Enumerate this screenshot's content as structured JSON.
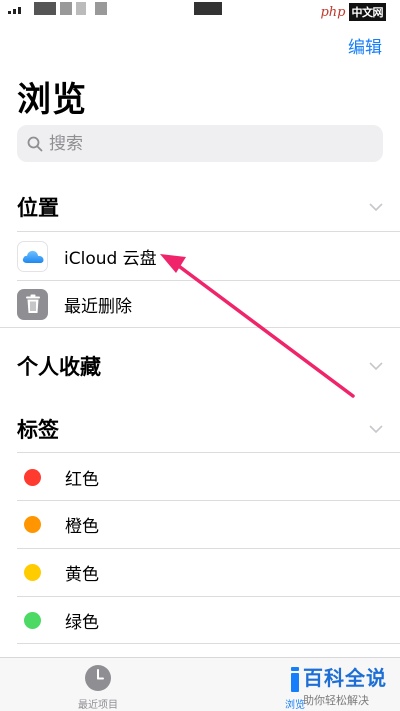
{
  "header": {
    "edit_label": "编辑",
    "title": "浏览"
  },
  "search": {
    "placeholder": "搜索"
  },
  "sections": {
    "locations": {
      "title": "位置",
      "items": [
        {
          "label": "iCloud 云盘",
          "icon": "icloud-icon"
        },
        {
          "label": "最近删除",
          "icon": "trash-icon"
        }
      ]
    },
    "favorites": {
      "title": "个人收藏"
    },
    "tags": {
      "title": "标签",
      "items": [
        {
          "label": "红色",
          "color": "#ff3b30"
        },
        {
          "label": "橙色",
          "color": "#ff9500"
        },
        {
          "label": "黄色",
          "color": "#ffcc00"
        },
        {
          "label": "绿色",
          "color": "#4cd964"
        }
      ]
    }
  },
  "tab_bar": {
    "tabs": [
      {
        "label": "最近项目",
        "icon": "clock-icon",
        "active": false
      },
      {
        "label": "浏览",
        "icon": "folder-icon",
        "active": true
      }
    ]
  },
  "watermarks": {
    "top_php": "php",
    "top_cn": "中文网",
    "bottom_title": "百科全说",
    "bottom_subtitle": "助你轻松解决"
  },
  "colors": {
    "accent": "#157efb",
    "annotation_arrow": "#f0246a"
  }
}
